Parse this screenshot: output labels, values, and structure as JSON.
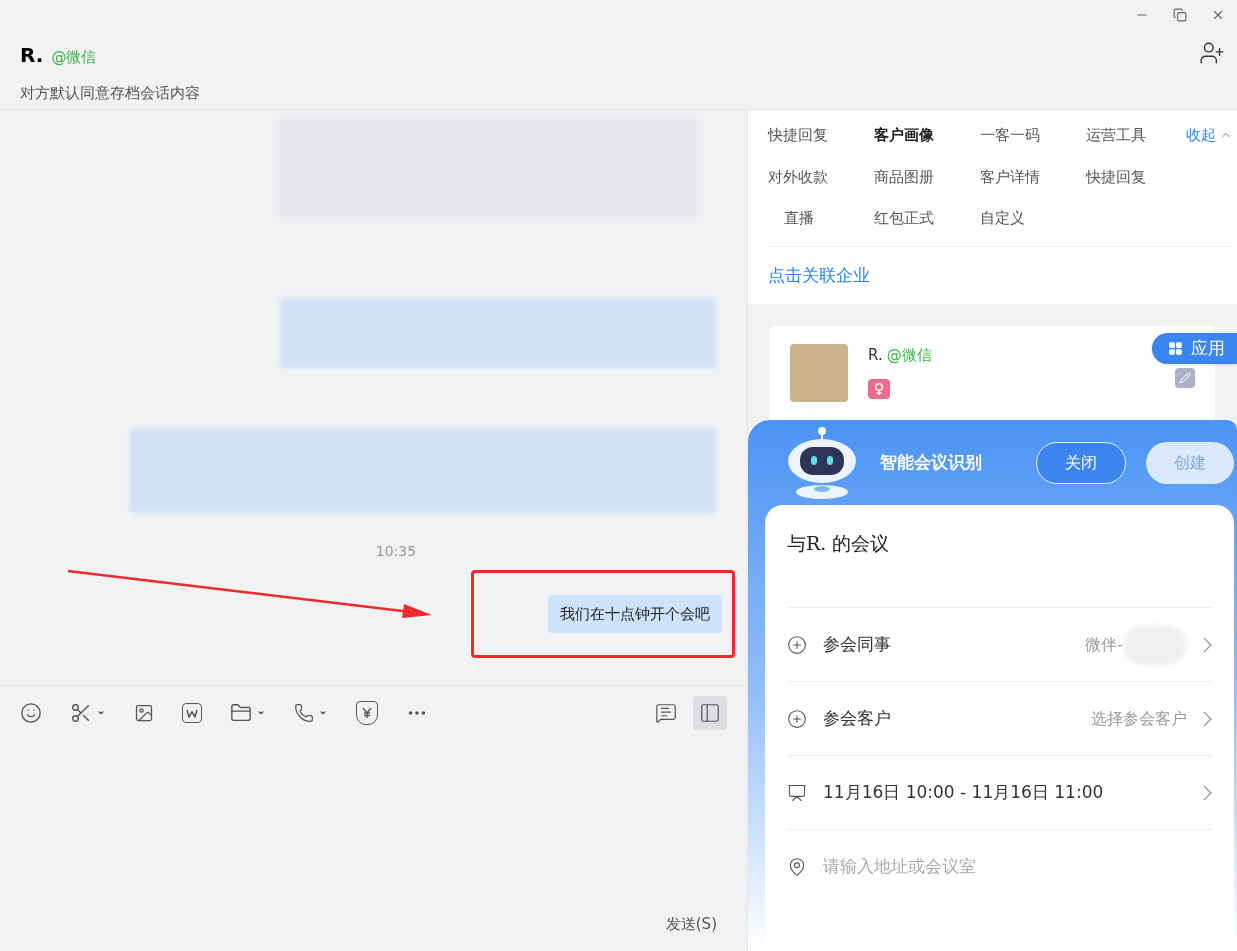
{
  "header": {
    "name": "R.",
    "tag": "@微信",
    "subtitle": "对方默认同意存档会话内容"
  },
  "chat": {
    "time": "10:35",
    "message": "我们在十点钟开个会吧",
    "send_label": "发送(S)",
    "panel_toggle_on": true
  },
  "tools": [
    {
      "label": "快捷回复",
      "selected": false
    },
    {
      "label": "客户画像",
      "selected": true
    },
    {
      "label": "一客一码",
      "selected": false
    },
    {
      "label": "运营工具",
      "selected": false
    },
    {
      "label": "对外收款",
      "selected": false
    },
    {
      "label": "商品图册",
      "selected": false
    },
    {
      "label": "客户详情",
      "selected": false
    },
    {
      "label": "快捷回复",
      "selected": false
    },
    {
      "label": "直播",
      "selected": false
    },
    {
      "label": "红包正式",
      "selected": false
    },
    {
      "label": "自定义",
      "selected": false
    }
  ],
  "collapse_label": "收起",
  "link": "点击关联企业",
  "customer": {
    "name": "R.",
    "tag": "@微信"
  },
  "apps_button": "应用",
  "meeting": {
    "title": "智能会议识别",
    "close": "关闭",
    "create": "创建",
    "subject": "与R. 的会议",
    "rows": [
      {
        "kind": "add",
        "label": "参会同事",
        "value": "微伴-",
        "blurred": true
      },
      {
        "kind": "add",
        "label": "参会客户",
        "value": "选择参会客户",
        "blurred": false
      },
      {
        "kind": "time",
        "label": "11月16日 10:00 - 11月16日 11:00"
      }
    ],
    "location_placeholder": "请输入地址或会议室"
  }
}
